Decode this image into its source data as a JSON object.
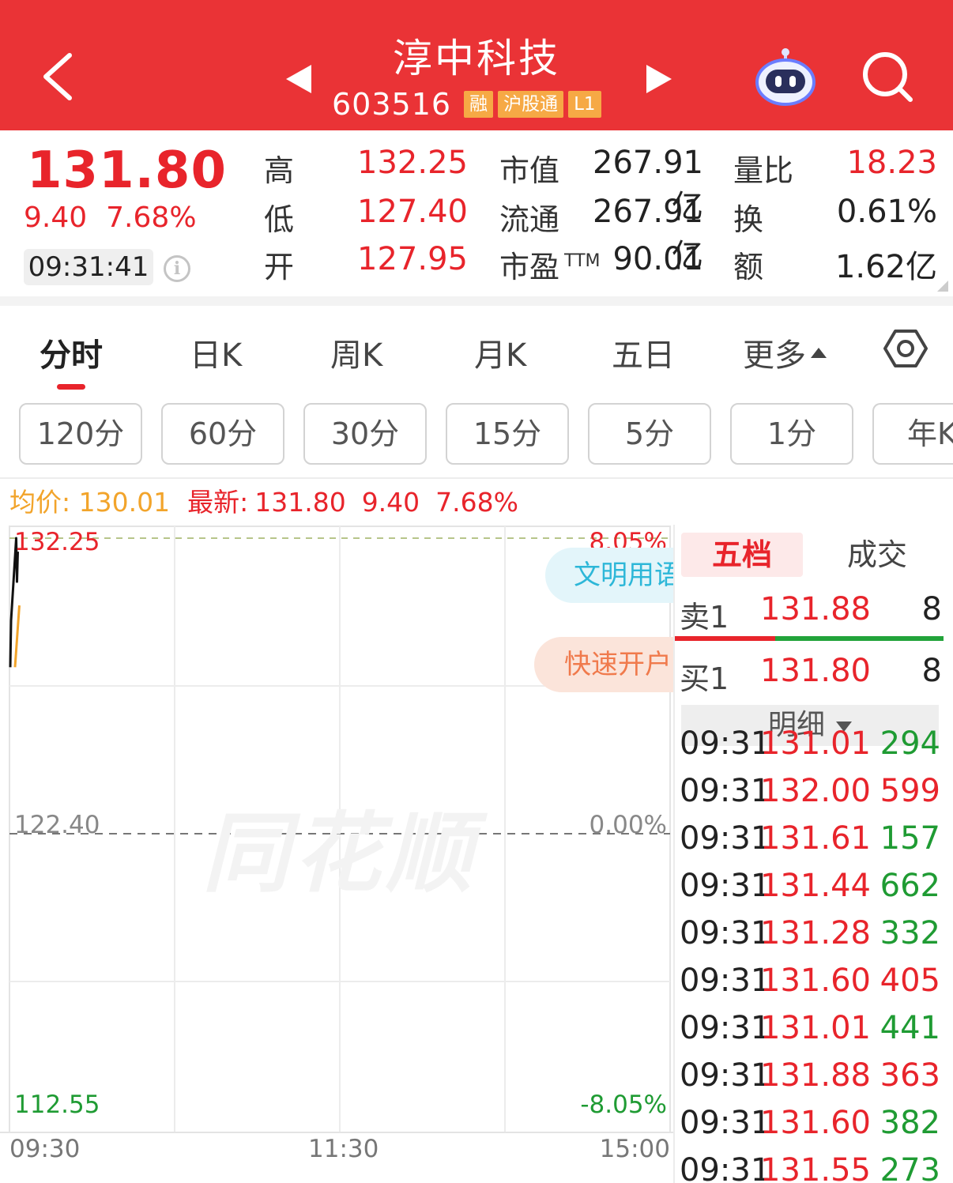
{
  "header": {
    "stock_name": "淳中科技",
    "stock_code": "603516",
    "tags": [
      "融",
      "沪股通",
      "L1"
    ]
  },
  "quote": {
    "price": "131.80",
    "change": "9.40",
    "change_pct": "7.68%",
    "time": "09:31:41",
    "high_label": "高",
    "high": "132.25",
    "low_label": "低",
    "low": "127.40",
    "open_label": "开",
    "open": "127.95",
    "mktcap_label": "市值",
    "mktcap": "267.91亿",
    "float_label": "流通",
    "float": "267.91亿",
    "pe_label": "市盈",
    "pe_sup": "TTM",
    "pe": "90.01",
    "vol_ratio_label": "量比",
    "vol_ratio": "18.23",
    "turnover_label": "换",
    "turnover": "0.61%",
    "amount_label": "额",
    "amount": "1.62亿"
  },
  "period_tabs": [
    "分时",
    "日K",
    "周K",
    "月K",
    "五日",
    "更多"
  ],
  "minute_chips": [
    "120分",
    "60分",
    "30分",
    "15分",
    "5分",
    "1分",
    "年K"
  ],
  "legend": {
    "avg_label": "均价:",
    "avg": "130.01",
    "latest_label": "最新:",
    "latest": "131.80",
    "latest_change": "9.40",
    "latest_pct": "7.68%"
  },
  "chart": {
    "y_top": "132.25",
    "y_mid": "122.40",
    "y_bottom": "112.55",
    "pct_top": "8.05%",
    "pct_mid": "0.00%",
    "pct_bottom": "-8.05%",
    "x_labels": [
      "09:30",
      "11:30",
      "15:00"
    ],
    "watermark": "同花顺",
    "pill_blue": "文明用语",
    "pill_orange": "快速开户"
  },
  "chart_data": {
    "type": "line",
    "title": "",
    "xlabel": "",
    "ylabel": "",
    "ylim": [
      112.55,
      132.25
    ],
    "x_range": [
      "09:30",
      "15:00"
    ],
    "series": [
      {
        "name": "",
        "color": "#111111",
        "x": [
          "09:30",
          "09:30",
          "09:31",
          "09:31",
          "09:31"
        ],
        "values": [
          127.95,
          129.5,
          132.25,
          130.8,
          131.8
        ]
      },
      {
        "name": "均价",
        "color": "#f2a42b",
        "x": [
          "09:30",
          "09:31"
        ],
        "values": [
          127.95,
          130.01
        ]
      }
    ]
  },
  "order_book": {
    "tab_five": "五档",
    "tab_deals": "成交",
    "sell1_label": "卖1",
    "sell1_price": "131.88",
    "sell1_vol": "8",
    "buy1_label": "买1",
    "buy1_price": "131.80",
    "buy1_vol": "8",
    "spread_sell_fraction": 0.37,
    "detail_label": "明细"
  },
  "ticks": [
    {
      "time": "09:31",
      "price": "131.01",
      "vol": "294",
      "dir": "green"
    },
    {
      "time": "09:31",
      "price": "132.00",
      "vol": "599",
      "dir": "red"
    },
    {
      "time": "09:31",
      "price": "131.61",
      "vol": "157",
      "dir": "green"
    },
    {
      "time": "09:31",
      "price": "131.44",
      "vol": "662",
      "dir": "green"
    },
    {
      "time": "09:31",
      "price": "131.28",
      "vol": "332",
      "dir": "green"
    },
    {
      "time": "09:31",
      "price": "131.60",
      "vol": "405",
      "dir": "red"
    },
    {
      "time": "09:31",
      "price": "131.01",
      "vol": "441",
      "dir": "green"
    },
    {
      "time": "09:31",
      "price": "131.88",
      "vol": "363",
      "dir": "red"
    },
    {
      "time": "09:31",
      "price": "131.60",
      "vol": "382",
      "dir": "green"
    },
    {
      "time": "09:31",
      "price": "131.55",
      "vol": "273",
      "dir": "green"
    }
  ],
  "colors": {
    "header_bg": "#ea3336",
    "up_red": "#e8242b",
    "down_green": "#1f9b33",
    "avg_orange": "#f2a42b",
    "tag_orange": "#f6a945"
  }
}
